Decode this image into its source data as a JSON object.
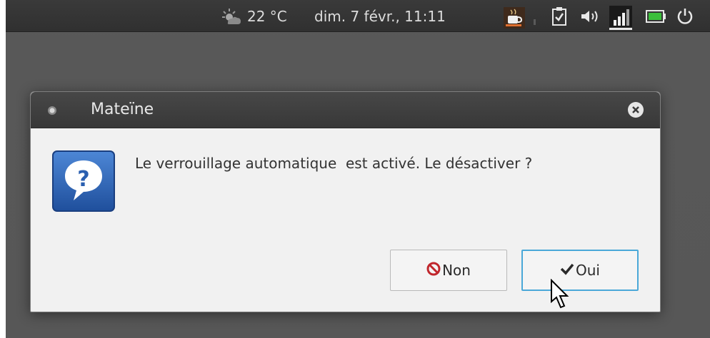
{
  "topbar": {
    "weather_icon": "weather-sun-cloud-icon",
    "temperature": "22 °C",
    "datetime": "dim.  7 févr., 11:11",
    "tray_icons": [
      "coffee-cup-icon",
      "clipboard-check-icon",
      "volume-icon",
      "signal-bars-icon",
      "battery-icon",
      "power-icon"
    ]
  },
  "dialog": {
    "title": "Mateïne",
    "message": "Le verrouillage automatique  est activé. Le désactiver ?",
    "icon": "question-icon",
    "buttons": {
      "no_label": "Non",
      "yes_label": "Oui"
    }
  },
  "colors": {
    "panel": "#353535",
    "dialog_bg": "#f1f1f1",
    "focus": "#4aa8d8",
    "no_icon": "#c0262c",
    "question_blue": "#2a5fb0"
  }
}
